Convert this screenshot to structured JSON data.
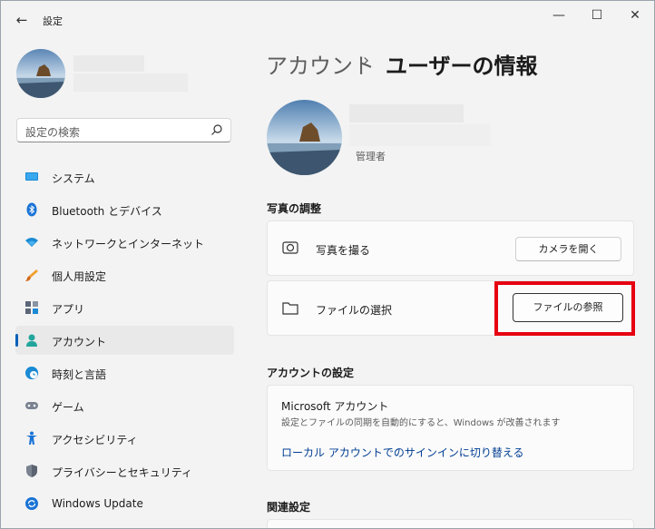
{
  "window": {
    "title": "設定"
  },
  "search": {
    "placeholder": "設定の検索"
  },
  "nav": [
    {
      "label": "システム",
      "icon": "monitor-icon"
    },
    {
      "label": "Bluetooth とデバイス",
      "icon": "bluetooth-icon"
    },
    {
      "label": "ネットワークとインターネット",
      "icon": "wifi-icon"
    },
    {
      "label": "個人用設定",
      "icon": "brush-icon"
    },
    {
      "label": "アプリ",
      "icon": "apps-icon"
    },
    {
      "label": "アカウント",
      "icon": "person-icon",
      "selected": true
    },
    {
      "label": "時刻と言語",
      "icon": "globe-clock-icon"
    },
    {
      "label": "ゲーム",
      "icon": "gamepad-icon"
    },
    {
      "label": "アクセシビリティ",
      "icon": "accessibility-icon"
    },
    {
      "label": "プライバシーとセキュリティ",
      "icon": "shield-icon"
    },
    {
      "label": "Windows Update",
      "icon": "update-icon"
    }
  ],
  "breadcrumb": {
    "parent": "アカウント",
    "separator": "›",
    "current": "ユーザーの情報"
  },
  "user": {
    "role": "管理者"
  },
  "photo_section": {
    "header": "写真の調整",
    "take_photo": {
      "label": "写真を撮る",
      "button": "カメラを開く"
    },
    "choose_file": {
      "label": "ファイルの選択",
      "button": "ファイルの参照"
    }
  },
  "account_section": {
    "header": "アカウントの設定",
    "title": "Microsoft アカウント",
    "description": "設定とファイルの同期を自動的にすると、Windows が改善されます",
    "link": "ローカル アカウントでのサインインに切り替える"
  },
  "related_section": {
    "header": "関連設定"
  },
  "colors": {
    "accent": "#005fb8",
    "highlight": "#e60012"
  }
}
